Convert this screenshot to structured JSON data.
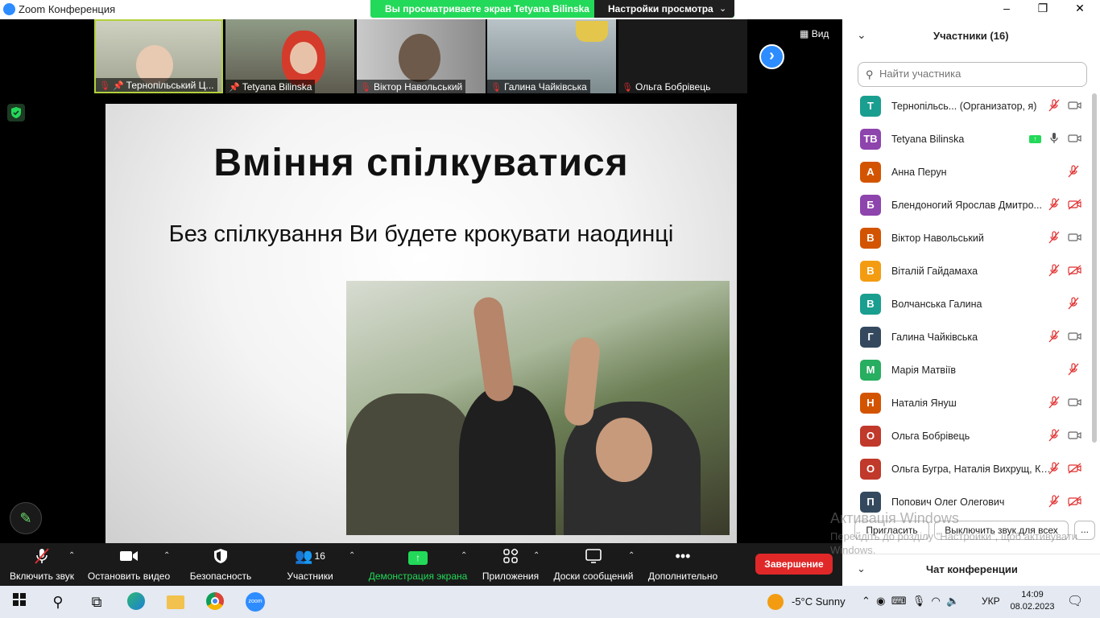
{
  "window": {
    "title": "Zoom Конференция",
    "share_banner": "Вы просматриваете экран Tetyana Bilinska",
    "view_settings": "Настройки просмотра",
    "view_button": "Вид",
    "controls": [
      "–",
      "❐",
      "✕"
    ]
  },
  "video_strip": [
    {
      "name": "Тернопільський Ц...",
      "muted": true,
      "pinned": true
    },
    {
      "name": "Tetyana Bilinska",
      "muted": false,
      "pinned": true
    },
    {
      "name": "Віктор Навольський",
      "muted": true,
      "pinned": false
    },
    {
      "name": "Галина Чайківська",
      "muted": true,
      "pinned": false
    },
    {
      "name": "Ольга Бобрівець",
      "muted": true,
      "pinned": false
    }
  ],
  "slide": {
    "title": "Вміння спілкуватися",
    "subtitle": "Без спілкування Ви будете крокувати наодинці"
  },
  "toolbar": {
    "mic": "Включить звук",
    "video": "Остановить видео",
    "security": "Безопасность",
    "participants": "Участники",
    "participants_count": "16",
    "share": "Демонстрация экрана",
    "apps": "Приложения",
    "whiteboards": "Доски сообщений",
    "more": "Дополнительно",
    "end": "Завершение"
  },
  "panel": {
    "title": "Участники (16)",
    "search_placeholder": "Найти участника",
    "participants": [
      {
        "initials": "Т",
        "color": "#1a9e8f",
        "name": "Тернопільсь...  (Организатор, я)",
        "mic": "off",
        "cam": "on",
        "sharing": false
      },
      {
        "initials": "ТВ",
        "color": "#8e44ad",
        "name": "Tetyana Bilinska",
        "mic": "on",
        "cam": "on",
        "sharing": true
      },
      {
        "initials": "А",
        "color": "#d35400",
        "name": "Анна Перун",
        "mic": "off",
        "cam": "none",
        "sharing": false
      },
      {
        "initials": "Б",
        "color": "#8e44ad",
        "name": "Блендоногий Ярослав Дмитро...",
        "mic": "off",
        "cam": "off",
        "sharing": false
      },
      {
        "initials": "В",
        "color": "#d35400",
        "name": "Віктор Навольський",
        "mic": "off",
        "cam": "on",
        "sharing": false
      },
      {
        "initials": "В",
        "color": "#f39c12",
        "name": "Віталій Гайдамаха",
        "mic": "off",
        "cam": "off",
        "sharing": false
      },
      {
        "initials": "В",
        "color": "#1a9e8f",
        "name": "Волчанська Галина",
        "mic": "off",
        "cam": "none",
        "sharing": false
      },
      {
        "initials": "Г",
        "color": "#34495e",
        "name": "Галина Чайківська",
        "mic": "off",
        "cam": "on",
        "sharing": false
      },
      {
        "initials": "М",
        "color": "#27ae60",
        "name": "Марія Матвіїв",
        "mic": "off",
        "cam": "none",
        "sharing": false
      },
      {
        "initials": "Н",
        "color": "#d35400",
        "name": "Наталія Януш",
        "mic": "off",
        "cam": "on",
        "sharing": false
      },
      {
        "initials": "О",
        "color": "#c0392b",
        "name": "Ольга Бобрівець",
        "mic": "off",
        "cam": "on",
        "sharing": false
      },
      {
        "initials": "О",
        "color": "#c0392b",
        "name": "Ольга Бугра, Наталія Вихрущ, Кат...",
        "mic": "off",
        "cam": "off",
        "sharing": false
      },
      {
        "initials": "П",
        "color": "#34495e",
        "name": "Попович Олег Олегович",
        "mic": "off",
        "cam": "off",
        "sharing": false
      }
    ],
    "invite": "Пригласить",
    "mute_all": "Выключить звук для всех",
    "more": "...",
    "chat_title": "Чат конференции"
  },
  "watermark": {
    "line1": "Активація Windows",
    "line2": "Перейдіть до розділу \"Настройки\", щоб активувати Windows."
  },
  "taskbar": {
    "weather": "-5°C  Sunny",
    "lang": "УКР",
    "time": "14:09",
    "date": "08.02.2023"
  }
}
